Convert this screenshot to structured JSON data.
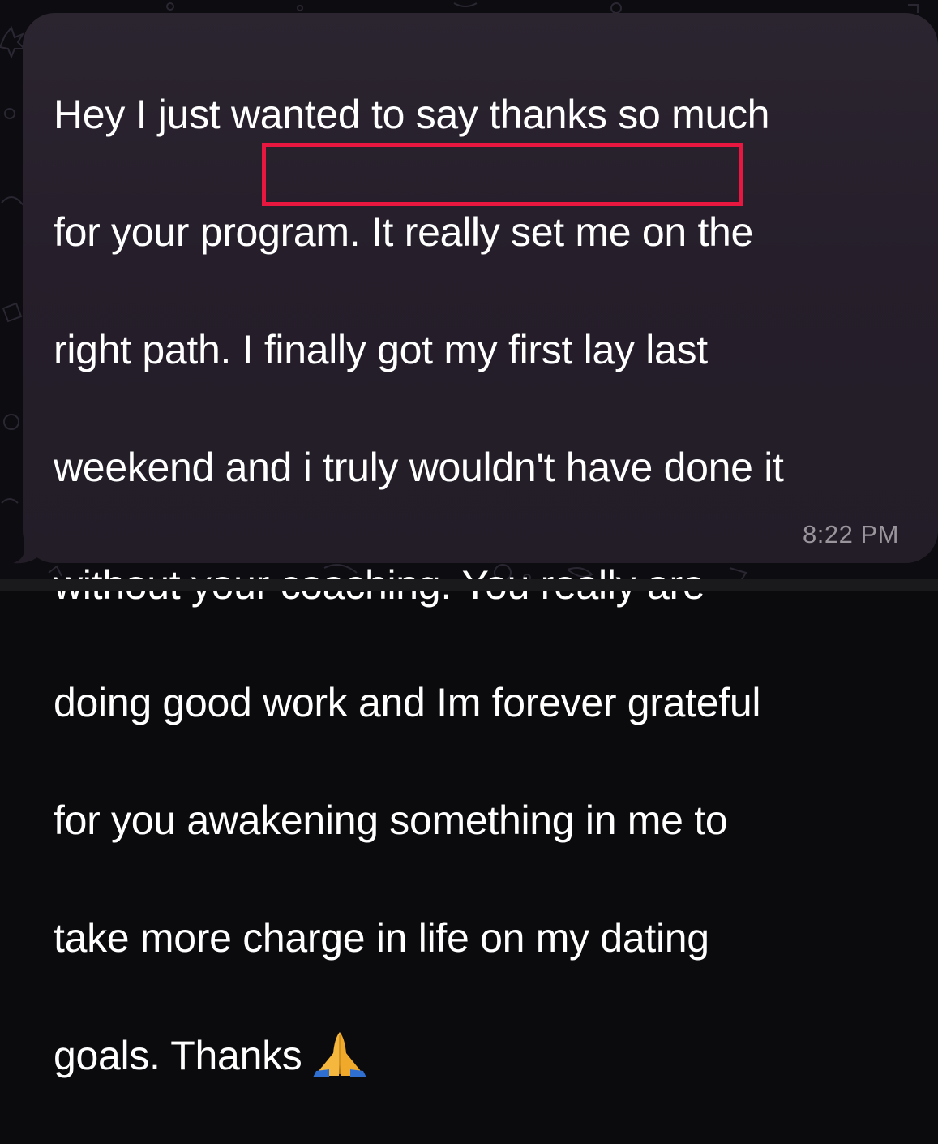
{
  "message": {
    "lines": [
      "Hey I just wanted to say thanks so much",
      "for your program. It really set me on the",
      "right path. I finally got my first lay last",
      "weekend and i truly wouldn't have done it",
      "without your coaching. You really are",
      "doing good work and Im forever grateful",
      "for you awakening something in me to",
      "take more charge in life on my dating",
      "goals. Thanks"
    ],
    "emoji": "folded-hands-emoji",
    "timestamp": "8:22 PM"
  },
  "colors": {
    "bubble": "#2b2530",
    "highlight_border": "#e8173f",
    "text": "#ffffff",
    "timestamp": "#9a949c"
  }
}
